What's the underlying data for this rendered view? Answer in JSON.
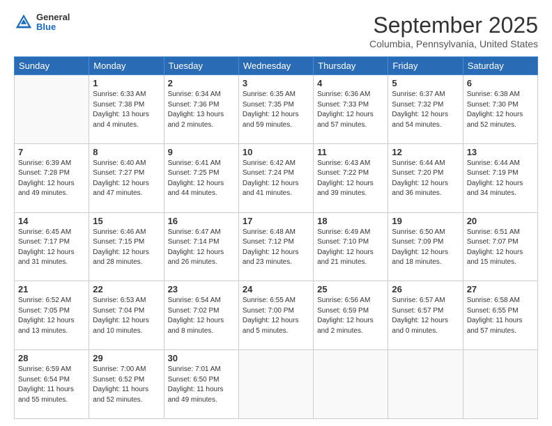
{
  "header": {
    "logo": {
      "line1": "General",
      "line2": "Blue"
    },
    "title": "September 2025",
    "location": "Columbia, Pennsylvania, United States"
  },
  "calendar": {
    "days_of_week": [
      "Sunday",
      "Monday",
      "Tuesday",
      "Wednesday",
      "Thursday",
      "Friday",
      "Saturday"
    ],
    "weeks": [
      [
        {
          "day": "",
          "info": ""
        },
        {
          "day": "1",
          "info": "Sunrise: 6:33 AM\nSunset: 7:38 PM\nDaylight: 13 hours\nand 4 minutes."
        },
        {
          "day": "2",
          "info": "Sunrise: 6:34 AM\nSunset: 7:36 PM\nDaylight: 13 hours\nand 2 minutes."
        },
        {
          "day": "3",
          "info": "Sunrise: 6:35 AM\nSunset: 7:35 PM\nDaylight: 12 hours\nand 59 minutes."
        },
        {
          "day": "4",
          "info": "Sunrise: 6:36 AM\nSunset: 7:33 PM\nDaylight: 12 hours\nand 57 minutes."
        },
        {
          "day": "5",
          "info": "Sunrise: 6:37 AM\nSunset: 7:32 PM\nDaylight: 12 hours\nand 54 minutes."
        },
        {
          "day": "6",
          "info": "Sunrise: 6:38 AM\nSunset: 7:30 PM\nDaylight: 12 hours\nand 52 minutes."
        }
      ],
      [
        {
          "day": "7",
          "info": "Sunrise: 6:39 AM\nSunset: 7:28 PM\nDaylight: 12 hours\nand 49 minutes."
        },
        {
          "day": "8",
          "info": "Sunrise: 6:40 AM\nSunset: 7:27 PM\nDaylight: 12 hours\nand 47 minutes."
        },
        {
          "day": "9",
          "info": "Sunrise: 6:41 AM\nSunset: 7:25 PM\nDaylight: 12 hours\nand 44 minutes."
        },
        {
          "day": "10",
          "info": "Sunrise: 6:42 AM\nSunset: 7:24 PM\nDaylight: 12 hours\nand 41 minutes."
        },
        {
          "day": "11",
          "info": "Sunrise: 6:43 AM\nSunset: 7:22 PM\nDaylight: 12 hours\nand 39 minutes."
        },
        {
          "day": "12",
          "info": "Sunrise: 6:44 AM\nSunset: 7:20 PM\nDaylight: 12 hours\nand 36 minutes."
        },
        {
          "day": "13",
          "info": "Sunrise: 6:44 AM\nSunset: 7:19 PM\nDaylight: 12 hours\nand 34 minutes."
        }
      ],
      [
        {
          "day": "14",
          "info": "Sunrise: 6:45 AM\nSunset: 7:17 PM\nDaylight: 12 hours\nand 31 minutes."
        },
        {
          "day": "15",
          "info": "Sunrise: 6:46 AM\nSunset: 7:15 PM\nDaylight: 12 hours\nand 28 minutes."
        },
        {
          "day": "16",
          "info": "Sunrise: 6:47 AM\nSunset: 7:14 PM\nDaylight: 12 hours\nand 26 minutes."
        },
        {
          "day": "17",
          "info": "Sunrise: 6:48 AM\nSunset: 7:12 PM\nDaylight: 12 hours\nand 23 minutes."
        },
        {
          "day": "18",
          "info": "Sunrise: 6:49 AM\nSunset: 7:10 PM\nDaylight: 12 hours\nand 21 minutes."
        },
        {
          "day": "19",
          "info": "Sunrise: 6:50 AM\nSunset: 7:09 PM\nDaylight: 12 hours\nand 18 minutes."
        },
        {
          "day": "20",
          "info": "Sunrise: 6:51 AM\nSunset: 7:07 PM\nDaylight: 12 hours\nand 15 minutes."
        }
      ],
      [
        {
          "day": "21",
          "info": "Sunrise: 6:52 AM\nSunset: 7:05 PM\nDaylight: 12 hours\nand 13 minutes."
        },
        {
          "day": "22",
          "info": "Sunrise: 6:53 AM\nSunset: 7:04 PM\nDaylight: 12 hours\nand 10 minutes."
        },
        {
          "day": "23",
          "info": "Sunrise: 6:54 AM\nSunset: 7:02 PM\nDaylight: 12 hours\nand 8 minutes."
        },
        {
          "day": "24",
          "info": "Sunrise: 6:55 AM\nSunset: 7:00 PM\nDaylight: 12 hours\nand 5 minutes."
        },
        {
          "day": "25",
          "info": "Sunrise: 6:56 AM\nSunset: 6:59 PM\nDaylight: 12 hours\nand 2 minutes."
        },
        {
          "day": "26",
          "info": "Sunrise: 6:57 AM\nSunset: 6:57 PM\nDaylight: 12 hours\nand 0 minutes."
        },
        {
          "day": "27",
          "info": "Sunrise: 6:58 AM\nSunset: 6:55 PM\nDaylight: 11 hours\nand 57 minutes."
        }
      ],
      [
        {
          "day": "28",
          "info": "Sunrise: 6:59 AM\nSunset: 6:54 PM\nDaylight: 11 hours\nand 55 minutes."
        },
        {
          "day": "29",
          "info": "Sunrise: 7:00 AM\nSunset: 6:52 PM\nDaylight: 11 hours\nand 52 minutes."
        },
        {
          "day": "30",
          "info": "Sunrise: 7:01 AM\nSunset: 6:50 PM\nDaylight: 11 hours\nand 49 minutes."
        },
        {
          "day": "",
          "info": ""
        },
        {
          "day": "",
          "info": ""
        },
        {
          "day": "",
          "info": ""
        },
        {
          "day": "",
          "info": ""
        }
      ]
    ]
  }
}
